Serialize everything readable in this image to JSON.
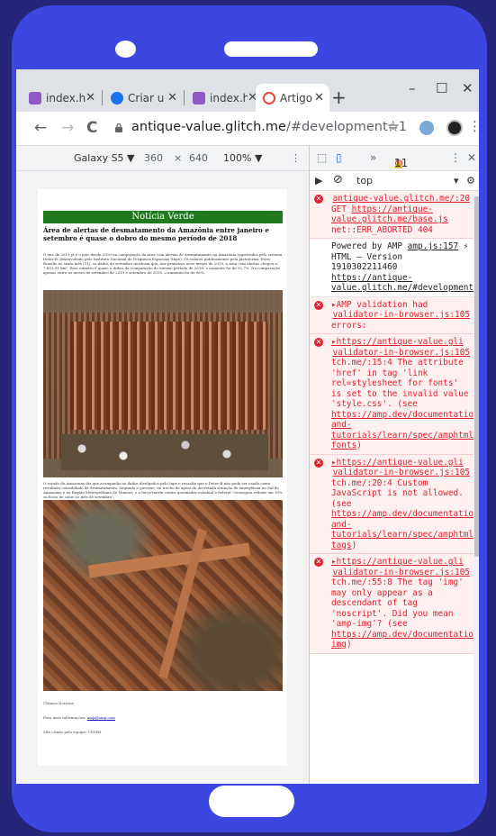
{
  "browser": {
    "tabs": [
      {
        "title": "index.h",
        "favicon_color": "#8e58c7",
        "active": false
      },
      {
        "title": "Criar u",
        "favicon_color": "#1a73e8",
        "active": false
      },
      {
        "title": "index.h",
        "favicon_color": "#8e58c7",
        "active": false
      },
      {
        "title": "Artigo",
        "favicon_color": "#e8453c",
        "active": true
      }
    ],
    "tab_close": "✕",
    "new_tab": "+",
    "window_controls": {
      "minimize": "–",
      "maximize": "☐",
      "close": "✕"
    },
    "nav": {
      "back": "←",
      "forward": "→",
      "reload": "C"
    },
    "url_host": "antique-value.glitch.me",
    "url_rest": "/#development=1",
    "star": "☆",
    "menu": "⋮"
  },
  "device_toolbar": {
    "device": "Galaxy S5 ▼",
    "width": "360",
    "times": "×",
    "height": "640",
    "zoom": "100% ▼",
    "more": "⋮"
  },
  "page": {
    "banner": "Notícia Verde",
    "headline": "Área de alertas de desmatamento da Amazônia entre janeiro e setembro é quase o dobro do mesmo período de 2018",
    "paragraph1": "O ano de 2019 já é o pior desde 2016 na comparação da área com alertas de desmatamento na Amazônia registrados pelo sistema Deter-B, desenvolvido pelo Instituto Nacional de Pesquisas Espaciais (Inpe). Os valores publicamente pela plataforma Terra Brasilis no sexto mês (31), os dados de setembro mostram que, nos primeiros nove meses de 2019, a área com alertas chegou a 7.853,91 km². Esse número é quase o dobro da comparação do mesmo período de 2018: o aumento foi de 92,7%. Na comparação apenas entre os meses de setembro de 2019 e setembro de 2018, o aumento foi de 96%.",
    "paragraph2": "O estado do Amazonas diz que acompanha os dados divulgados pelo Inpe e ressalta que o Deter-B não pode ser usado como resultado consolidado de desmatamento. Segundo o governo, no trecho de apoio do decretada situação de emergência no Sul do Amazonas e na Região Metropolitana de Manaus, e a força-tarefa contra queimadas estadual e federal \"conseguiu reduzir em 39% os focos de calor no mês de setembro\".",
    "footer_title": "Últimas Notícias",
    "footer_info_prefix": "Para mais informações: ",
    "footer_info_link": "amp@amp.com",
    "footer_credit": "Site criado pela equipe: CDVIM"
  },
  "devtools": {
    "toolbar": {
      "inspect": "⬚",
      "device_mode": "▯",
      "more_panels": "»",
      "error_count": "11",
      "warning_count": "1",
      "menu": "⋮",
      "close": "✕"
    },
    "filter": {
      "play": "▶",
      "block": "⃠",
      "context": "top",
      "dropdown": "▾",
      "settings": "⚙"
    },
    "messages": [
      {
        "type": "error",
        "source": "antique-value.glitch.me/:20",
        "text_lines": [
          "GET ",
          "https://antique-value.glitch.me/base.js",
          " net::ERR_ABORTED 404"
        ]
      },
      {
        "type": "info",
        "prefix": "Powered by AMP ",
        "source": "amp.js:157",
        "body": "⚡ HTML – Version 1910302211460 ",
        "link": "https://antique-value.glitch.me/#development=1"
      },
      {
        "type": "error",
        "head": "▸AMP validation had ",
        "source": "validator-in-browser.js:105",
        "text": "errors:"
      },
      {
        "type": "error",
        "head": "▸https://antique-value.gli ",
        "source": "validator-in-browser.js:105",
        "text": "tch.me/:15:4 The attribute 'href' in tag 'link rel=stylesheet for fonts' is set to the invalid value 'style.css'. (see ",
        "link": "https://amp.dev/documentation/guides-and-tutorials/learn/spec/amphtml#custom-fonts",
        "tail": ")"
      },
      {
        "type": "error",
        "head": "▸https://antique-value.gli ",
        "source": "validator-in-browser.js:105",
        "text": "tch.me/:20:4 Custom JavaScript is not allowed. (see ",
        "link": "https://amp.dev/documentation/guides-and-tutorials/learn/spec/amphtml#html-tags",
        "tail": ")"
      },
      {
        "type": "error",
        "head": "▸https://antique-value.gli ",
        "source": "validator-in-browser.js:105",
        "text": "tch.me/:55:8 The tag 'img' may only appear as a descendant of tag 'noscript'. Did you mean 'amp-img'? (see ",
        "link": "https://amp.dev/documentation/components/amp-img",
        "tail": ")"
      }
    ]
  },
  "colors": {
    "background": "#25257a",
    "phone_body": "#3b47e0",
    "banner_green": "#1f7a1f",
    "error_red": "#e0222e"
  }
}
